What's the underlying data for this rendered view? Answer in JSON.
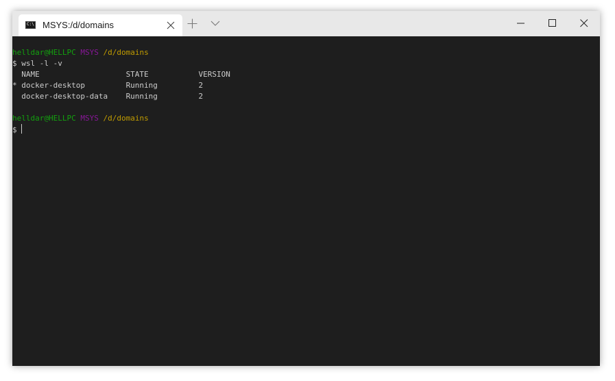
{
  "tab": {
    "title": "MSYS:/d/domains",
    "icon": "console-icon"
  },
  "colors": {
    "user": "#13a10e",
    "system": "#881798",
    "path": "#c19c00",
    "text": "#cccccc",
    "background": "#1e1e1e"
  },
  "prompt1": {
    "user": "helldar@HELLPC",
    "system": "MSYS",
    "path": "/d/domains"
  },
  "command1": {
    "symbol": "$",
    "text": "wsl -l -v"
  },
  "output": {
    "header": "  NAME                   STATE           VERSION",
    "rows": [
      "* docker-desktop         Running         2",
      "  docker-desktop-data    Running         2"
    ]
  },
  "prompt2": {
    "user": "helldar@HELLPC",
    "system": "MSYS",
    "path": "/d/domains"
  },
  "command2": {
    "symbol": "$",
    "text": ""
  }
}
